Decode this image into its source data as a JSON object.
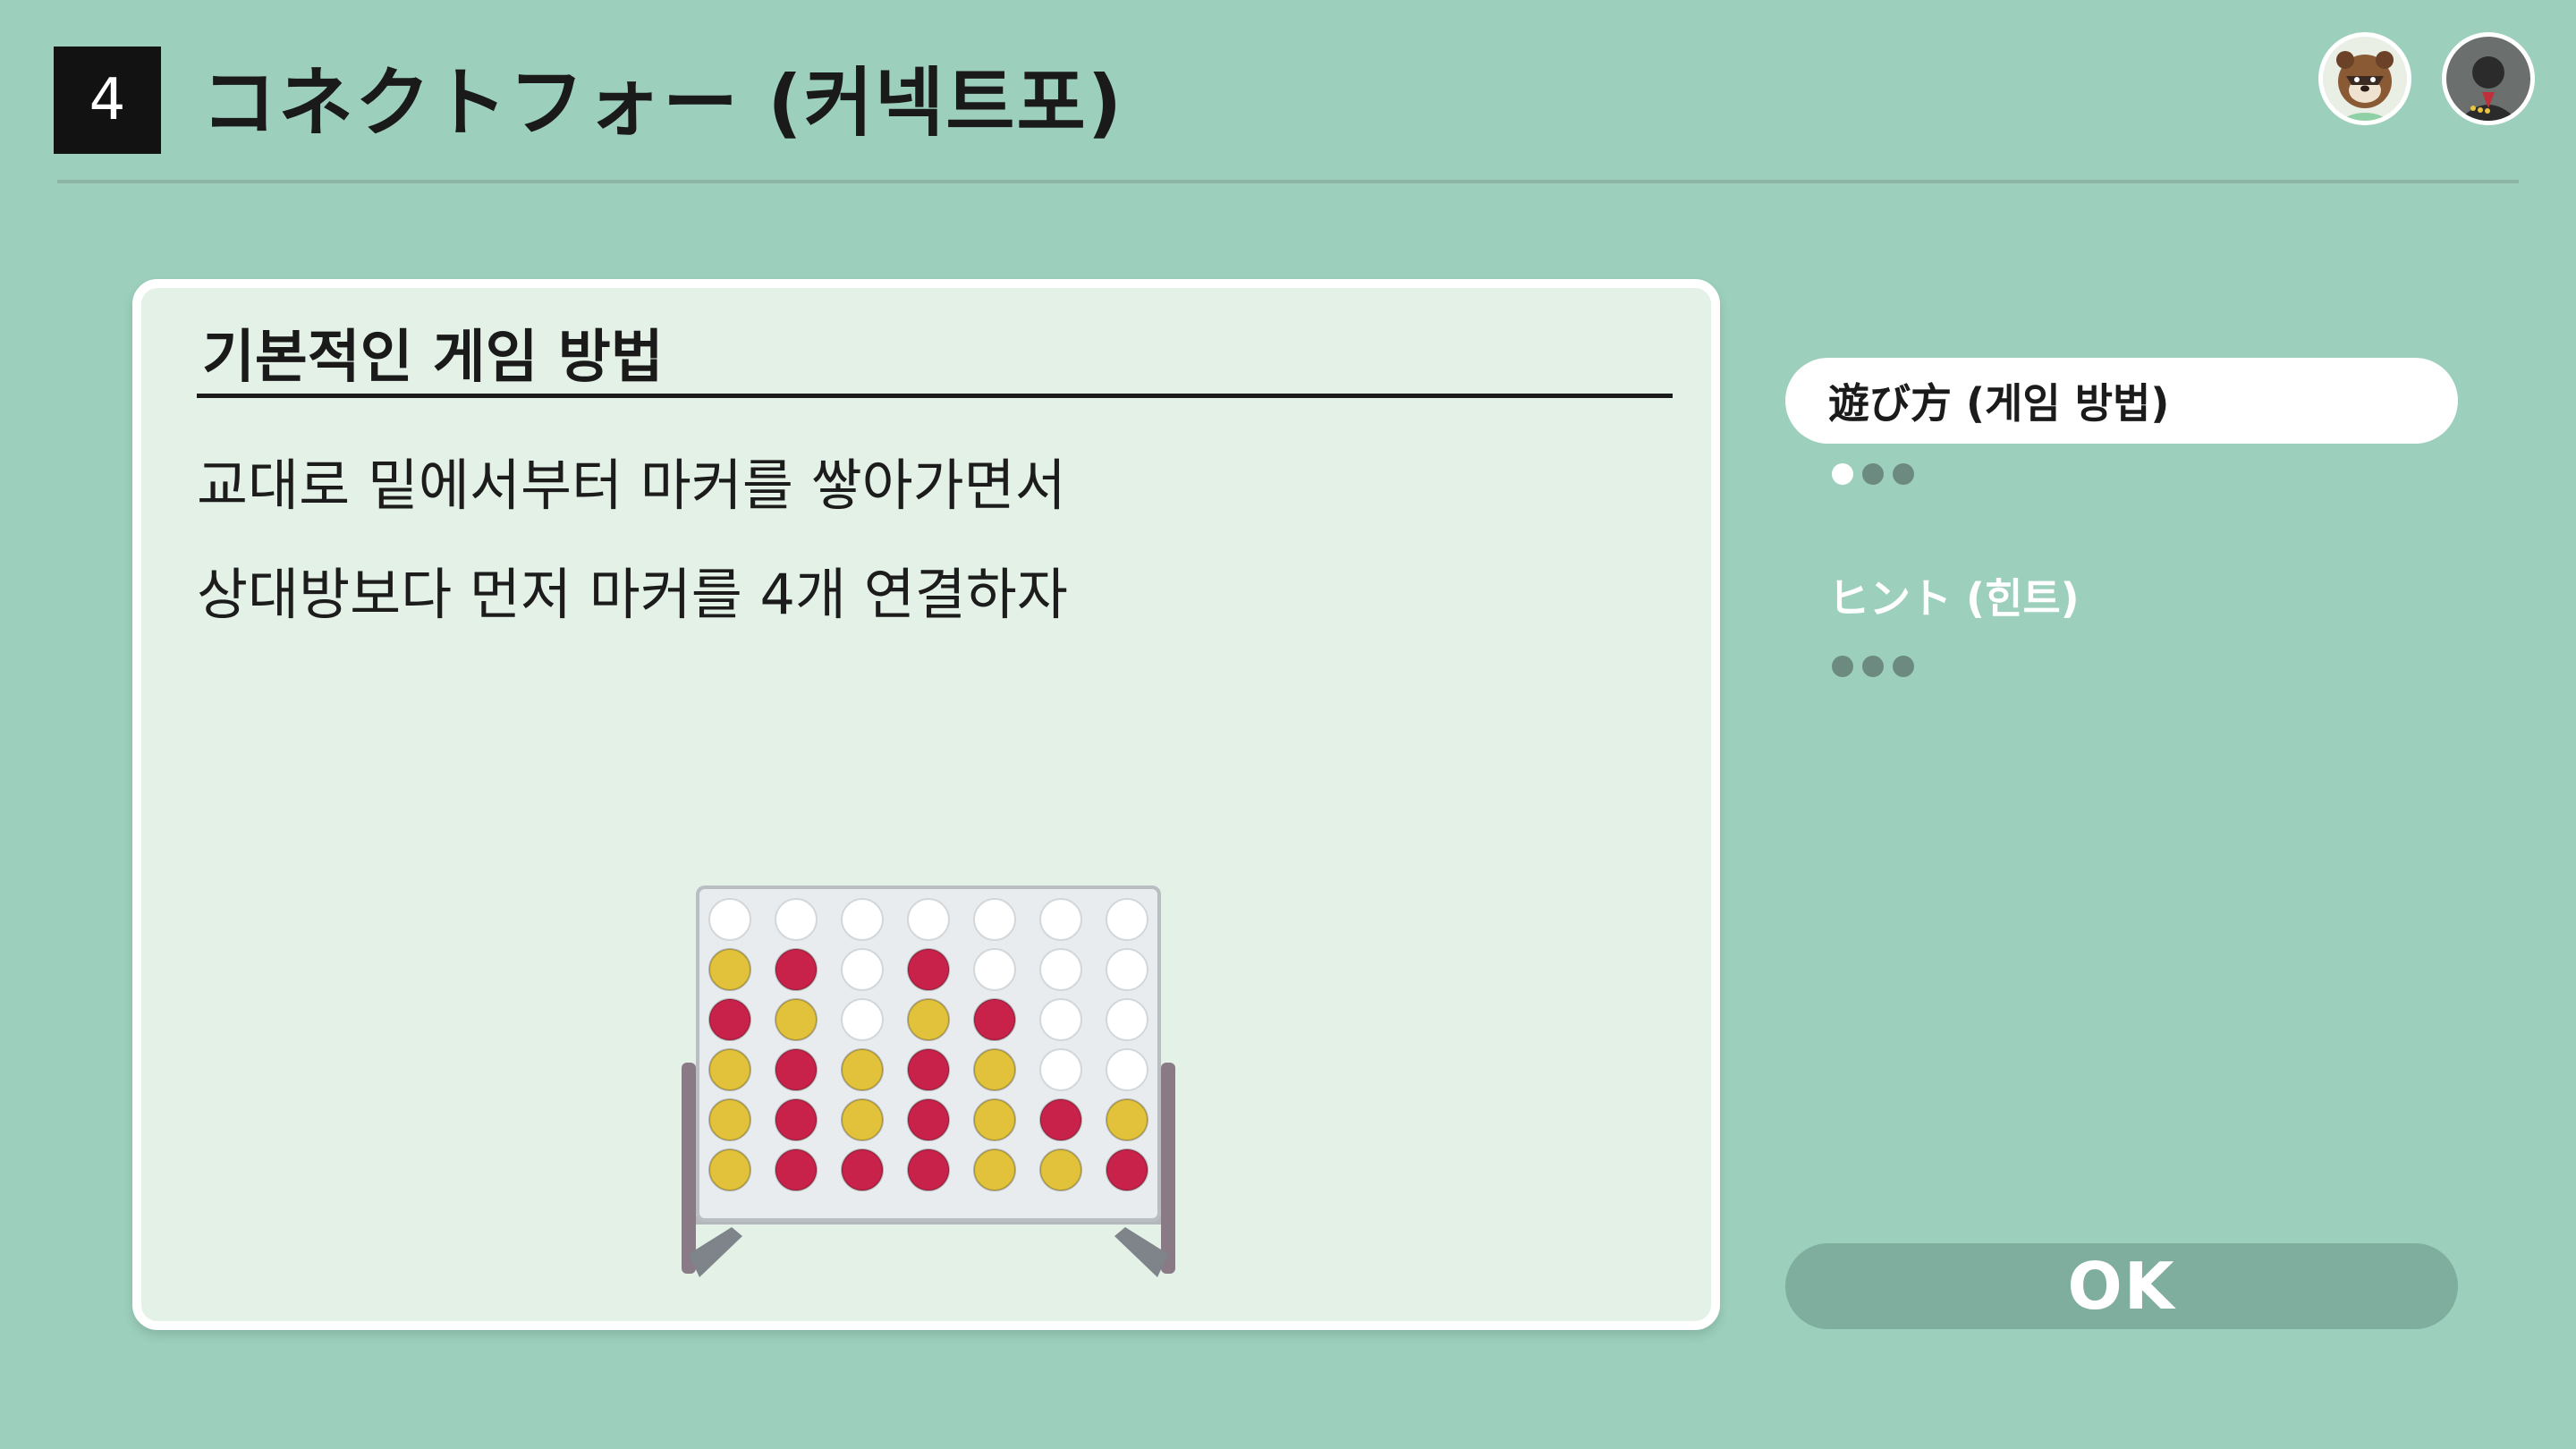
{
  "header": {
    "game_number": "4",
    "title": "コネクトフォー (커넥트포)"
  },
  "panel": {
    "heading": "기본적인 게임 방법",
    "lines": [
      "교대로 밑에서부터 마커를 쌓아가면서",
      "상대방보다 먼저 마커를 4개 연결하자"
    ]
  },
  "board": {
    "columns": 7,
    "rows": 6,
    "grid_top_to_bottom": [
      [
        "empty",
        "empty",
        "empty",
        "empty",
        "empty",
        "empty",
        "empty"
      ],
      [
        "yellow",
        "red",
        "empty",
        "red",
        "empty",
        "empty",
        "empty"
      ],
      [
        "red",
        "yellow",
        "empty",
        "yellow",
        "red",
        "empty",
        "empty"
      ],
      [
        "yellow",
        "red",
        "yellow",
        "red",
        "yellow",
        "empty",
        "empty"
      ],
      [
        "yellow",
        "red",
        "yellow",
        "red",
        "yellow",
        "red",
        "yellow"
      ],
      [
        "yellow",
        "red",
        "red",
        "red",
        "yellow",
        "yellow",
        "red"
      ]
    ],
    "colors": {
      "red": "#c8224a",
      "yellow": "#e2c23a",
      "empty": "#ffffff",
      "frame": "#8a8f94"
    }
  },
  "sidebar": {
    "tabs": [
      {
        "label": "遊び方 (게임 방법)",
        "active": true,
        "page_dots": 3,
        "current_page": 1
      },
      {
        "label": "ヒント (힌트)",
        "active": false,
        "page_dots": 3,
        "current_page": 0
      }
    ]
  },
  "ok_button": {
    "label": "OK"
  },
  "avatars": [
    {
      "icon": "tom-nook-avatar-icon"
    },
    {
      "icon": "player-avatar-icon"
    }
  ],
  "theme": {
    "background": "#9dcfbd",
    "panel_bg": "#e3f1e6",
    "accent_dark": "#121212"
  }
}
